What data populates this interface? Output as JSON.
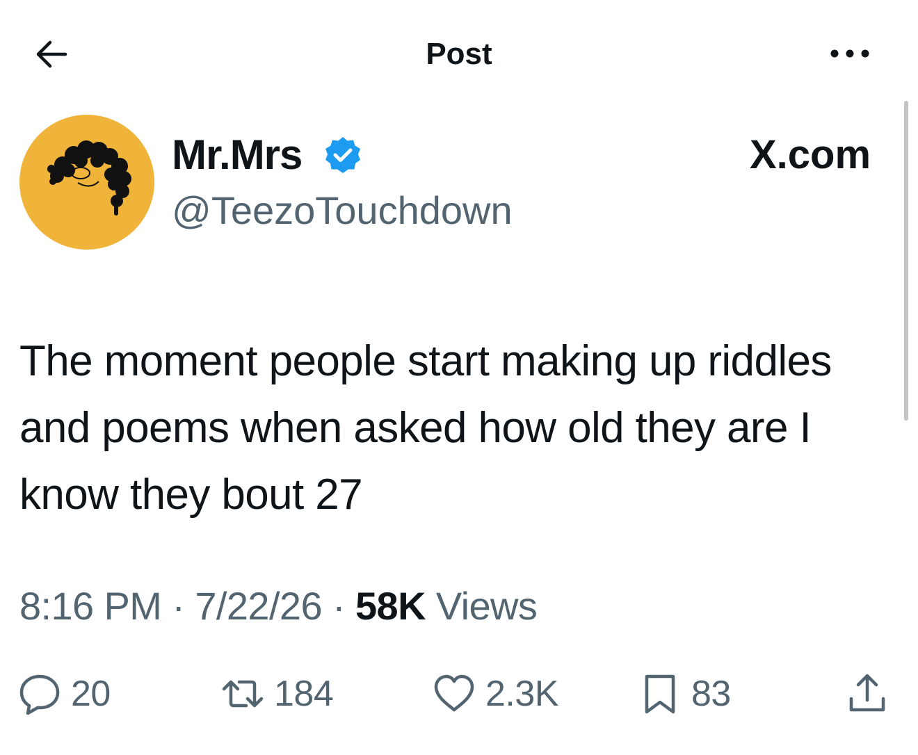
{
  "header": {
    "title": "Post",
    "back_icon": "arrow-left-icon",
    "more_icon": "more-horizontal-icon"
  },
  "author": {
    "display_name": "Mr.Mrs",
    "verified": true,
    "verified_color": "#1d9bf0",
    "handle": "@TeezoTouchdown",
    "avatar_color": "#f0b43b"
  },
  "watermark": "X.com",
  "tweet": {
    "text": "The moment people start making up riddles and poems when asked how old they are I know they bout 27",
    "time": "8:16 PM",
    "separator": "·",
    "date": "7/22/26",
    "views_count": "58K",
    "views_label": "Views"
  },
  "actions": {
    "replies": "20",
    "reposts": "184",
    "likes": "2.3K",
    "bookmarks": "83"
  },
  "colors": {
    "text": "#0f1419",
    "secondary": "#536471",
    "accent": "#1d9bf0"
  }
}
